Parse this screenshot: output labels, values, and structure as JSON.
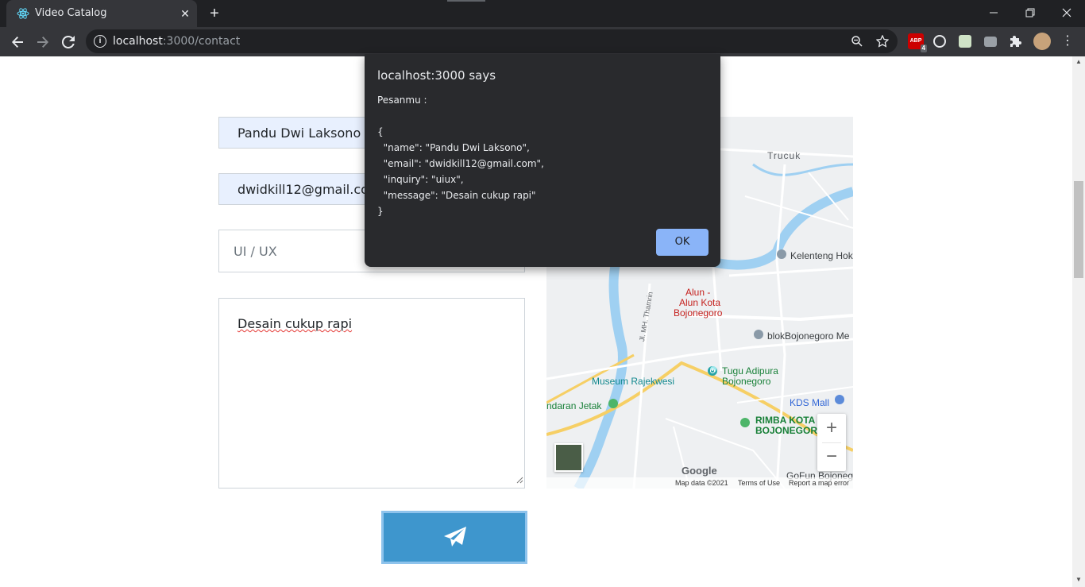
{
  "browser": {
    "tab_title": "Video Catalog",
    "tab_close": "✕",
    "new_tab": "+",
    "url_host": "localhost",
    "url_path": ":3000/contact",
    "extension_badge": "4",
    "ext_label": "ABP"
  },
  "form": {
    "name_value": "Pandu Dwi Laksono",
    "email_value": "dwidkill12@gmail.com",
    "inquiry_value": "UI / UX",
    "message_value": "Desain cukup rapi"
  },
  "map": {
    "labels": {
      "trucuk": "Trucuk",
      "kelenteng": "Kelenteng Hok",
      "alun1": "Alun -",
      "alun2": "Alun Kota",
      "alun3": "Bojonegoro",
      "jalan": "Jl. MH. Thamrin",
      "blok": "blokBojonegoro Me",
      "tugu1": "Tugu Adipura",
      "tugu2": "Bojonegoro",
      "museum": "Museum Rajekwesi",
      "bandaran": "ndaran Jetak",
      "kds": "KDS Mall",
      "rimba1": "RIMBA KOTA",
      "rimba2": "BOJONEGORO",
      "gofun": "GoFun Bojoneg",
      "google": "Google",
      "map_data": "Map data ©2021",
      "terms": "Terms of Use",
      "report": "Report a map error"
    },
    "zoom_in": "+",
    "zoom_out": "−"
  },
  "dialog": {
    "title": "localhost:3000 says",
    "body": "Pesanmu :\n\n{\n  \"name\": \"Pandu Dwi Laksono\",\n  \"email\": \"dwidkill12@gmail.com\",\n  \"inquiry\": \"uiux\",\n  \"message\": \"Desain cukup rapi\"\n}",
    "ok_label": "OK"
  }
}
